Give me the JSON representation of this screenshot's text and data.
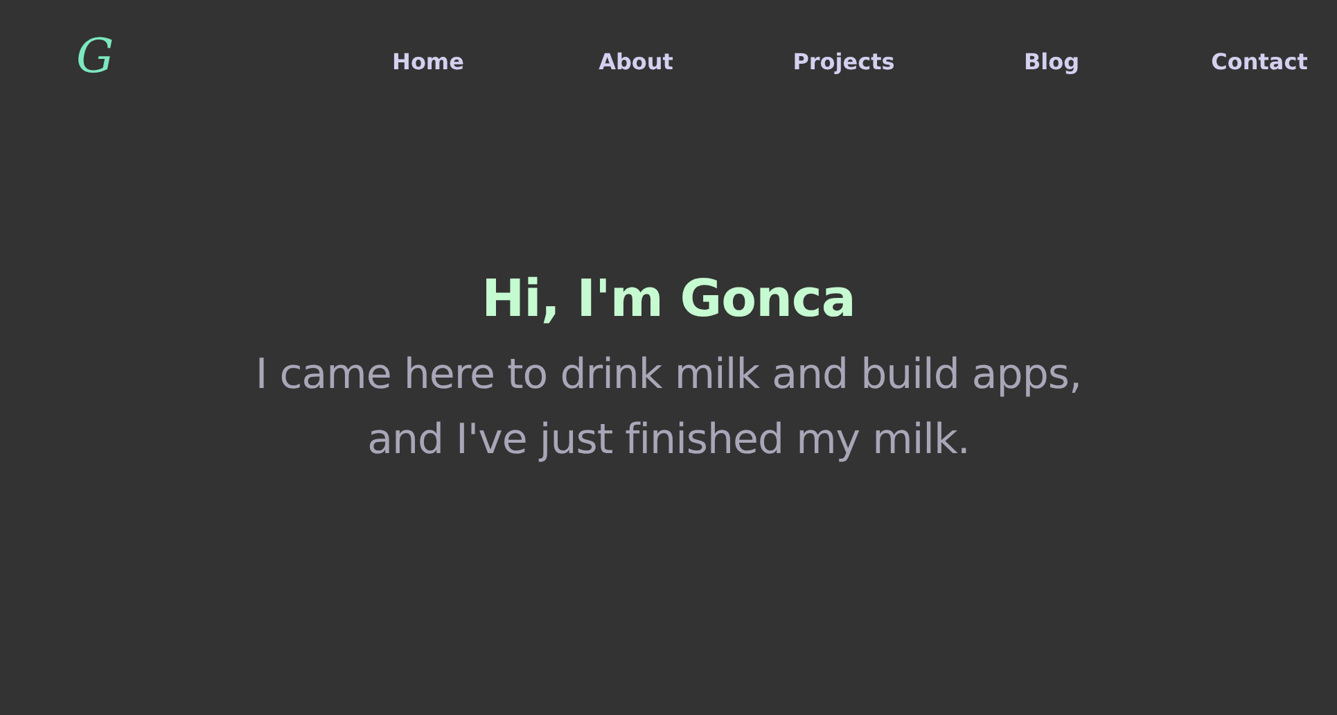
{
  "logo": {
    "text": "G"
  },
  "nav": [
    {
      "label": "Home"
    },
    {
      "label": "About"
    },
    {
      "label": "Projects"
    },
    {
      "label": "Blog"
    },
    {
      "label": "Contact"
    }
  ],
  "hero": {
    "title": "Hi, I'm Gonca",
    "lines": [
      "I came here to drink milk and build apps,",
      "and I've just finished my milk."
    ]
  }
}
